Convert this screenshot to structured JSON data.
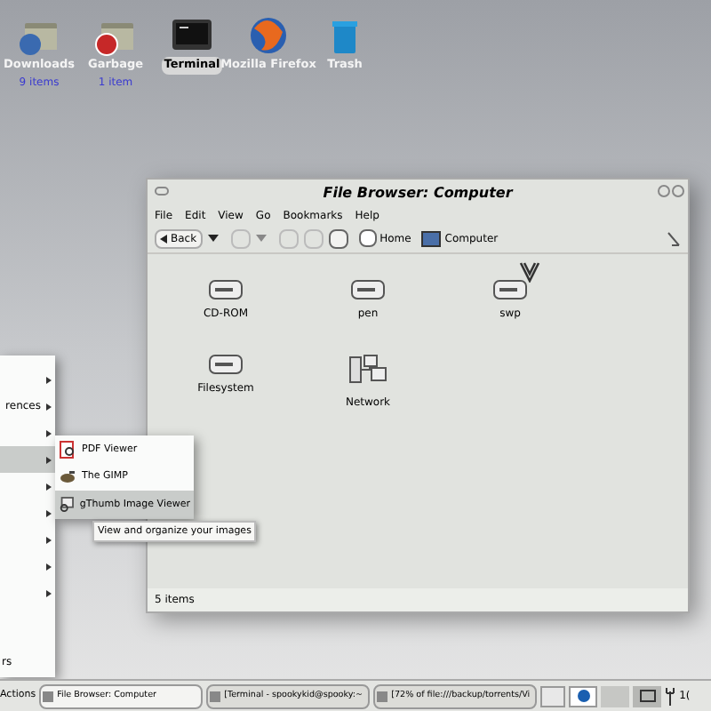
{
  "desktop_icons": [
    {
      "kind": "folder-globe",
      "label": "Downloads",
      "sublabel": "9 items",
      "selected": false
    },
    {
      "kind": "folder-alert",
      "label": "Garbage",
      "sublabel": "1 item",
      "selected": false
    },
    {
      "kind": "terminal",
      "label": "Terminal",
      "selected": true
    },
    {
      "kind": "browser",
      "label": "Mozilla Firefox",
      "selected": false
    },
    {
      "kind": "trash",
      "label": "Trash",
      "selected": false
    }
  ],
  "window": {
    "title": "File Browser: Computer",
    "menu": [
      "File",
      "Edit",
      "View",
      "Go",
      "Bookmarks",
      "Help"
    ],
    "toolbar": {
      "back": "Back",
      "home": "Home",
      "location": "Computer"
    },
    "items": [
      {
        "kind": "drive",
        "label": "CD-ROM"
      },
      {
        "kind": "drive",
        "label": "pen"
      },
      {
        "kind": "drive",
        "label": "swp"
      },
      {
        "kind": "drive",
        "label": "Filesystem"
      },
      {
        "kind": "network",
        "label": "Network"
      }
    ],
    "status": "5 items"
  },
  "menu": {
    "items": [
      {
        "selected": false
      },
      {
        "label": "rences",
        "selected": false
      },
      {
        "selected": false
      },
      {
        "selected": true
      },
      {
        "selected": false
      },
      {
        "selected": false
      },
      {
        "selected": false
      },
      {
        "selected": false
      },
      {
        "selected": false
      }
    ],
    "footer": "rs",
    "submenu": [
      {
        "kind": "pdf",
        "label": "PDF Viewer",
        "selected": false
      },
      {
        "kind": "gimp",
        "label": "The GIMP",
        "selected": false
      },
      {
        "kind": "viewer",
        "label": "gThumb Image Viewer",
        "selected": true
      }
    ],
    "tooltip": "View and organize your images"
  },
  "taskbar": {
    "actions": "Actions",
    "tasks": [
      {
        "label": "File Browser: Computer",
        "selected": true
      },
      {
        "label": "[Terminal - spookykid@spooky:~",
        "selected": false
      },
      {
        "label": "[72% of file:///backup/torrents/Vi",
        "selected": false
      }
    ],
    "clock": "1("
  }
}
